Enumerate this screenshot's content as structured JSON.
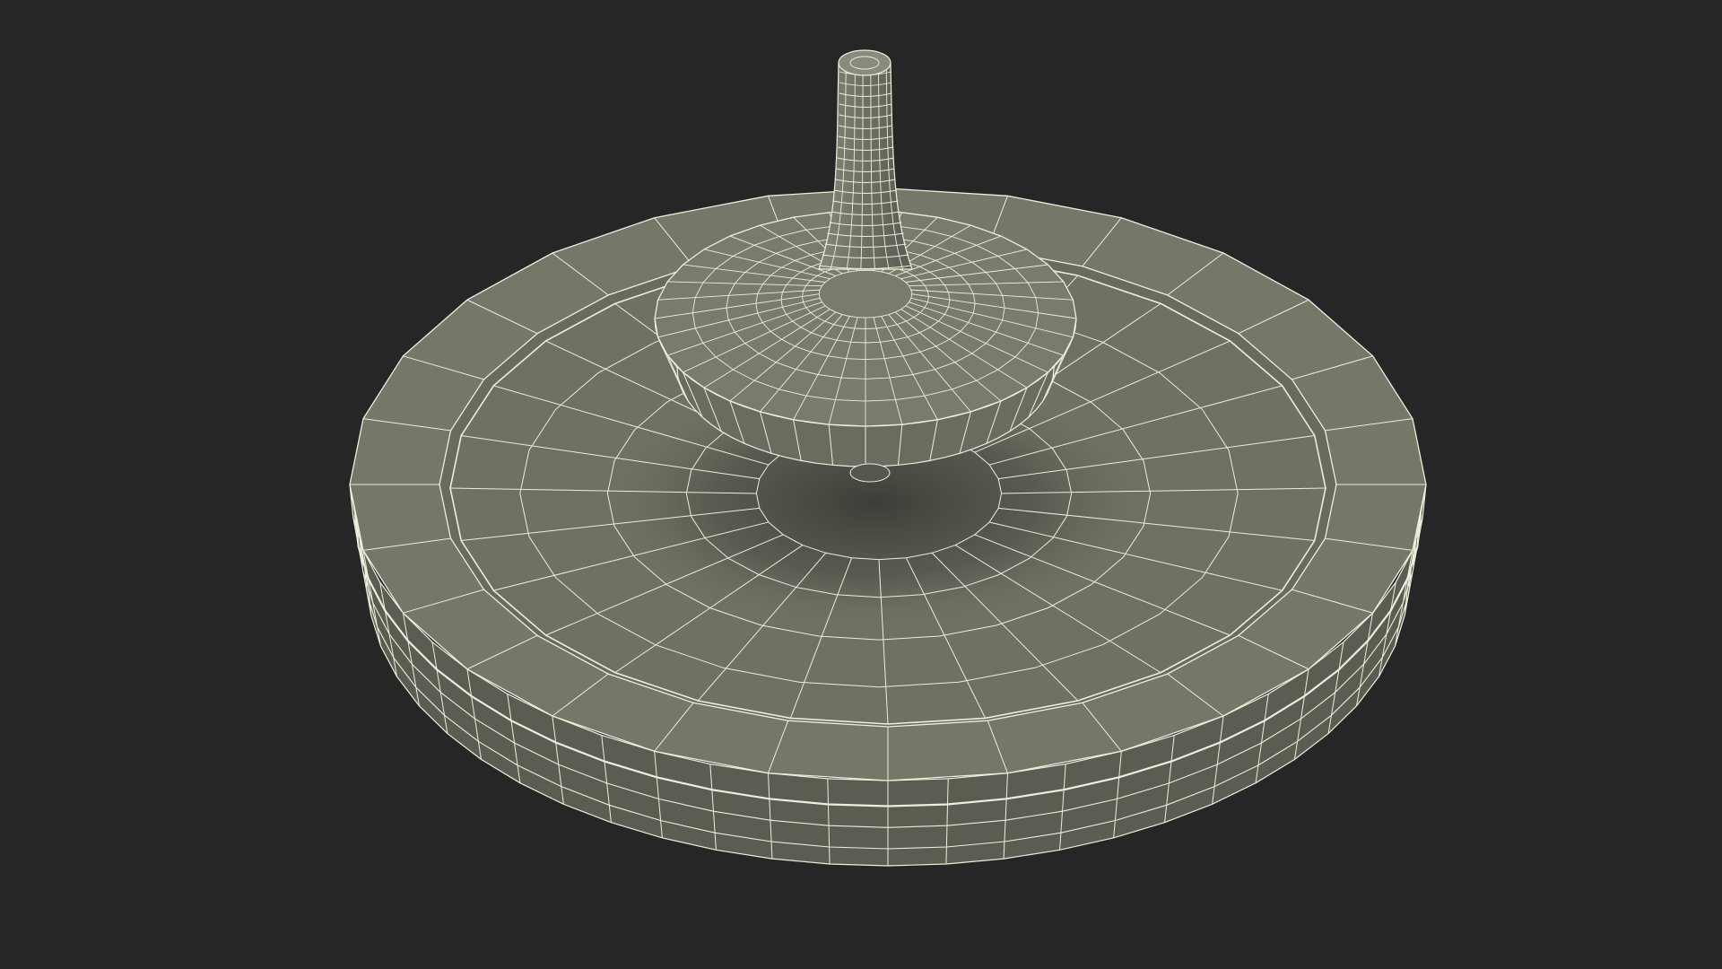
{
  "scene": {
    "subject": "spinning-top-wireframe",
    "colors": {
      "background": "#262626",
      "surface": "#767768",
      "surface_dark": "#5c5d52",
      "shadow": "#3a3b35",
      "wire": "#ecefdc"
    }
  }
}
